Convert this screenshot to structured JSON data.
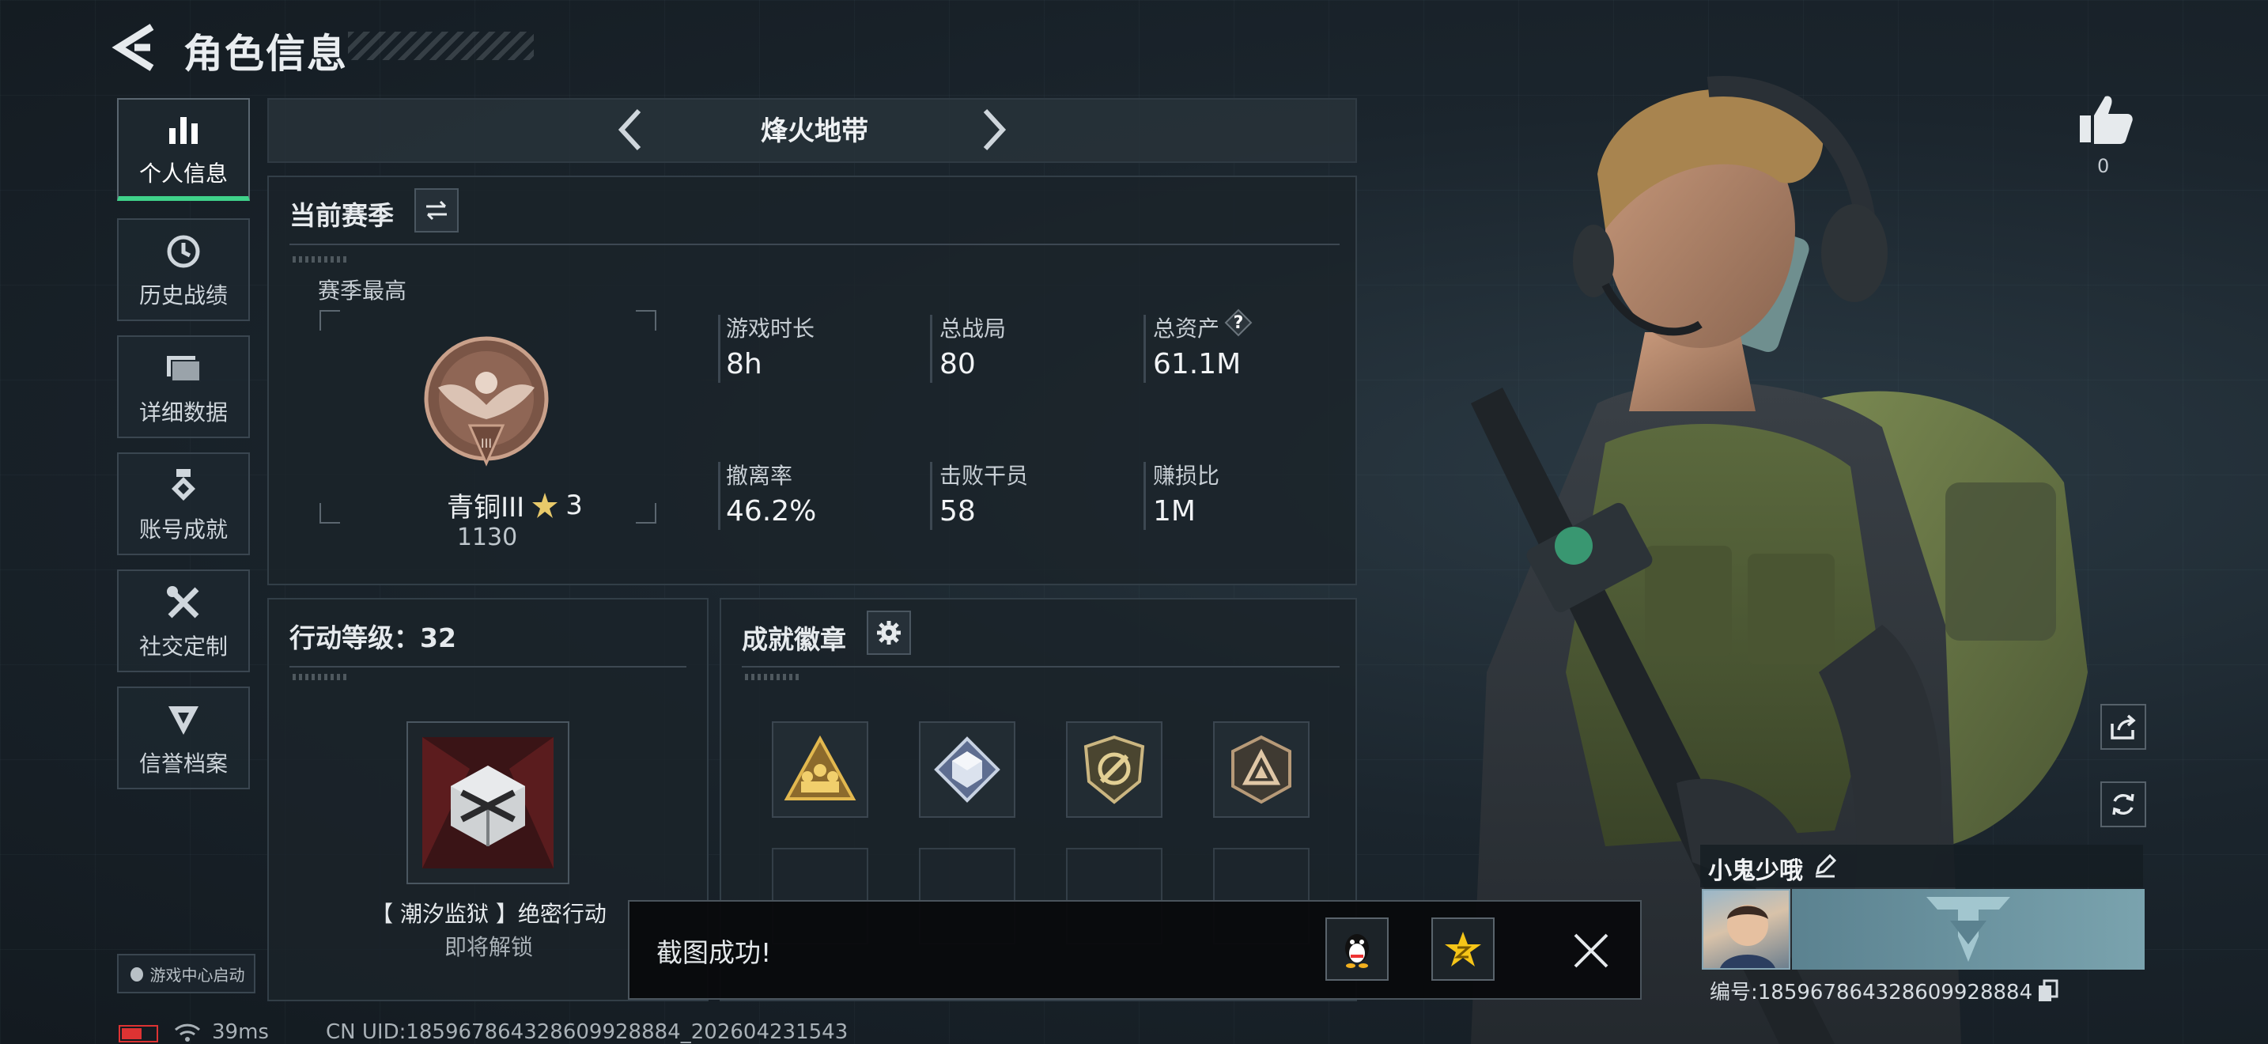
{
  "header": {
    "title": "角色信息"
  },
  "sidebar": {
    "items": [
      {
        "label": "个人信息",
        "icon": "bar-chart-icon",
        "active": true
      },
      {
        "label": "历史战绩",
        "icon": "history-icon",
        "active": false
      },
      {
        "label": "详细数据",
        "icon": "folder-icon",
        "active": false
      },
      {
        "label": "账号成就",
        "icon": "medal-icon",
        "active": false
      },
      {
        "label": "社交定制",
        "icon": "tools-icon",
        "active": false
      },
      {
        "label": "信誉档案",
        "icon": "shield-icon",
        "active": false
      }
    ],
    "game_center": "游戏中心启动"
  },
  "mode_bar": {
    "name": "烽火地带"
  },
  "season": {
    "title": "当前赛季",
    "best_label": "赛季最高",
    "rank_name": "青铜III",
    "rank_stars": "3",
    "rank_score": "1130",
    "stats": [
      {
        "label": "游戏时长",
        "value": "8h"
      },
      {
        "label": "总战局",
        "value": "80"
      },
      {
        "label": "总资产",
        "value": "61.1M",
        "help": "?"
      },
      {
        "label": "撤离率",
        "value": "46.2%"
      },
      {
        "label": "击败干员",
        "value": "58"
      },
      {
        "label": "赚损比",
        "value": "1M"
      }
    ]
  },
  "action_level": {
    "title": "行动等级：32",
    "item_name": "【 潮汐监狱 】绝密行动",
    "item_status": "即将解锁"
  },
  "badges": {
    "title": "成就徽章"
  },
  "toast": {
    "text": "截图成功!"
  },
  "right": {
    "like_count": "0",
    "player_name": "小鬼少哦",
    "player_id": "编号:185967864328609928884"
  },
  "status": {
    "latency": "39ms",
    "uid": "CN UID:185967864328609928884_202604231543"
  },
  "colors": {
    "accent": "#3fd28a",
    "battery": "#dd3333"
  }
}
